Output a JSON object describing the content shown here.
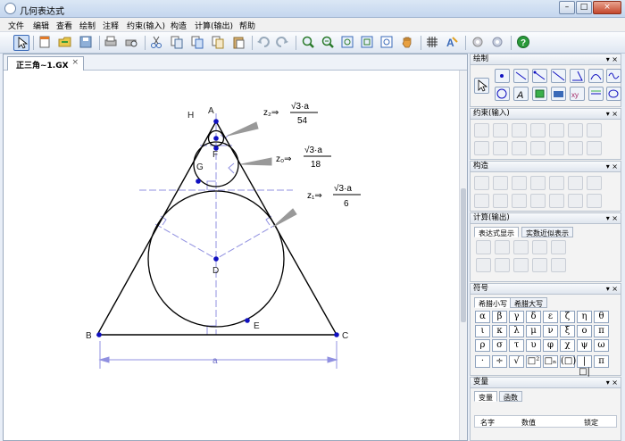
{
  "window": {
    "title": "几何表达式",
    "minimize": "–",
    "maximize": "□",
    "close": "×"
  },
  "menu": [
    "文件",
    "编辑",
    "查看",
    "绘制",
    "注释",
    "约束(输入)",
    "构造",
    "计算(输出)",
    "帮助"
  ],
  "document": {
    "tab_label": "正三角~1.GX",
    "tab_close": "×"
  },
  "figure": {
    "points": {
      "A": "A",
      "B": "B",
      "C": "C",
      "D": "D",
      "E": "E",
      "F": "F",
      "G": "G",
      "H": "H"
    },
    "side_label": "a",
    "z2": {
      "lhs": "z₂⇒",
      "num": "√3·a",
      "den": "54"
    },
    "z0": {
      "lhs": "z₀⇒",
      "num": "√3·a",
      "den": "18"
    },
    "z1": {
      "lhs": "z₁⇒",
      "num": "√3·a",
      "den": "6"
    }
  },
  "panels": {
    "draw": {
      "title": "绘制"
    },
    "constraint": {
      "title": "约束(输入)"
    },
    "construct": {
      "title": "构造"
    },
    "calc": {
      "title": "计算(输出)",
      "tab_expr": "表达式显示",
      "tab_approx": "实数近似表示"
    },
    "symbols": {
      "title": "符号",
      "tab_lower": "希腊小写",
      "tab_upper": "希腊大写",
      "greek": [
        "α",
        "β",
        "γ",
        "δ",
        "ε",
        "ζ",
        "η",
        "θ",
        "ι",
        "κ",
        "λ",
        "μ",
        "ν",
        "ξ",
        "ο",
        "π",
        "ρ",
        "σ",
        "τ",
        "υ",
        "φ",
        "χ",
        "ψ",
        "ω"
      ],
      "ops": [
        "·",
        "÷",
        "√",
        "□²",
        "□ₙ",
        "(□)",
        "|□|",
        "π"
      ]
    },
    "variables": {
      "title": "变量",
      "tab_vars": "变量",
      "tab_funcs": "函数",
      "col_name": "名字",
      "col_value": "数值",
      "col_lock": "锁定"
    },
    "header_buttons": "▾ ×"
  },
  "colors": {
    "accent": "#3a6ab8",
    "construction": "#9090e0",
    "points": "#1010c0"
  }
}
